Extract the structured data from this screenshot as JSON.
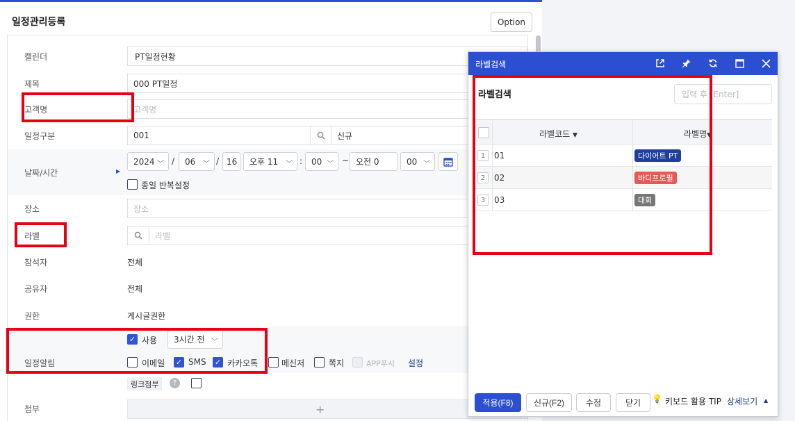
{
  "main": {
    "title": "일정관리등록",
    "option_label": "Option"
  },
  "form": {
    "calendar": {
      "label": "캘린더",
      "value": "PT일정현황"
    },
    "subject": {
      "label": "제목",
      "value": "000 PT일정"
    },
    "customer": {
      "label": "고객명",
      "placeholder": "고객명"
    },
    "category": {
      "label": "일정구분",
      "code": "001",
      "name": "신규"
    },
    "datetime": {
      "label": "날짜/시간",
      "year": "2024",
      "month": "06",
      "day": "16",
      "sep1": "/",
      "sep2": "/",
      "colon": ":",
      "tilde": "~",
      "start_ampm": "오후 11",
      "start_min": "00",
      "end_ampm": "오전 0",
      "end_min": "00",
      "repeat_label": "종일 반복설정"
    },
    "place": {
      "label": "장소",
      "placeholder": "장소"
    },
    "label_field": {
      "label": "라벨",
      "placeholder": "라벨"
    },
    "attendees": {
      "label": "참석자",
      "value": "전체"
    },
    "sharers": {
      "label": "공유자",
      "value": "전체"
    },
    "permission": {
      "label": "권한",
      "value": "게시글권한"
    },
    "alarm": {
      "label": "일정알림",
      "use_label": "사용",
      "time_value": "3시간 전",
      "options": [
        "이메일",
        "SMS",
        "카카오톡",
        "메신저",
        "쪽지",
        "APP푸시"
      ],
      "settings_label": "설정"
    },
    "link": {
      "label": "링크첨부",
      "help": "?"
    },
    "attach": {
      "label": "첨부",
      "add": "+"
    }
  },
  "popup": {
    "title": "라벨검색",
    "body_title": "라벨검색",
    "search_placeholder": "입력 후 [Enter]",
    "columns": [
      "라벨코드",
      "라벨명"
    ],
    "rows": [
      {
        "num": "1",
        "code": "01",
        "name": "다이어트 PT",
        "color": "#1f3f9e"
      },
      {
        "num": "2",
        "code": "02",
        "name": "바디프로필",
        "color": "#e65a55"
      },
      {
        "num": "3",
        "code": "03",
        "name": "대회",
        "color": "#777777"
      }
    ],
    "buttons": {
      "apply": "적용(F8)",
      "new": "신규(F2)",
      "edit": "수정",
      "close": "닫기"
    },
    "tip_label": "키보드 활용 TIP",
    "tip_link": "상세보기"
  }
}
